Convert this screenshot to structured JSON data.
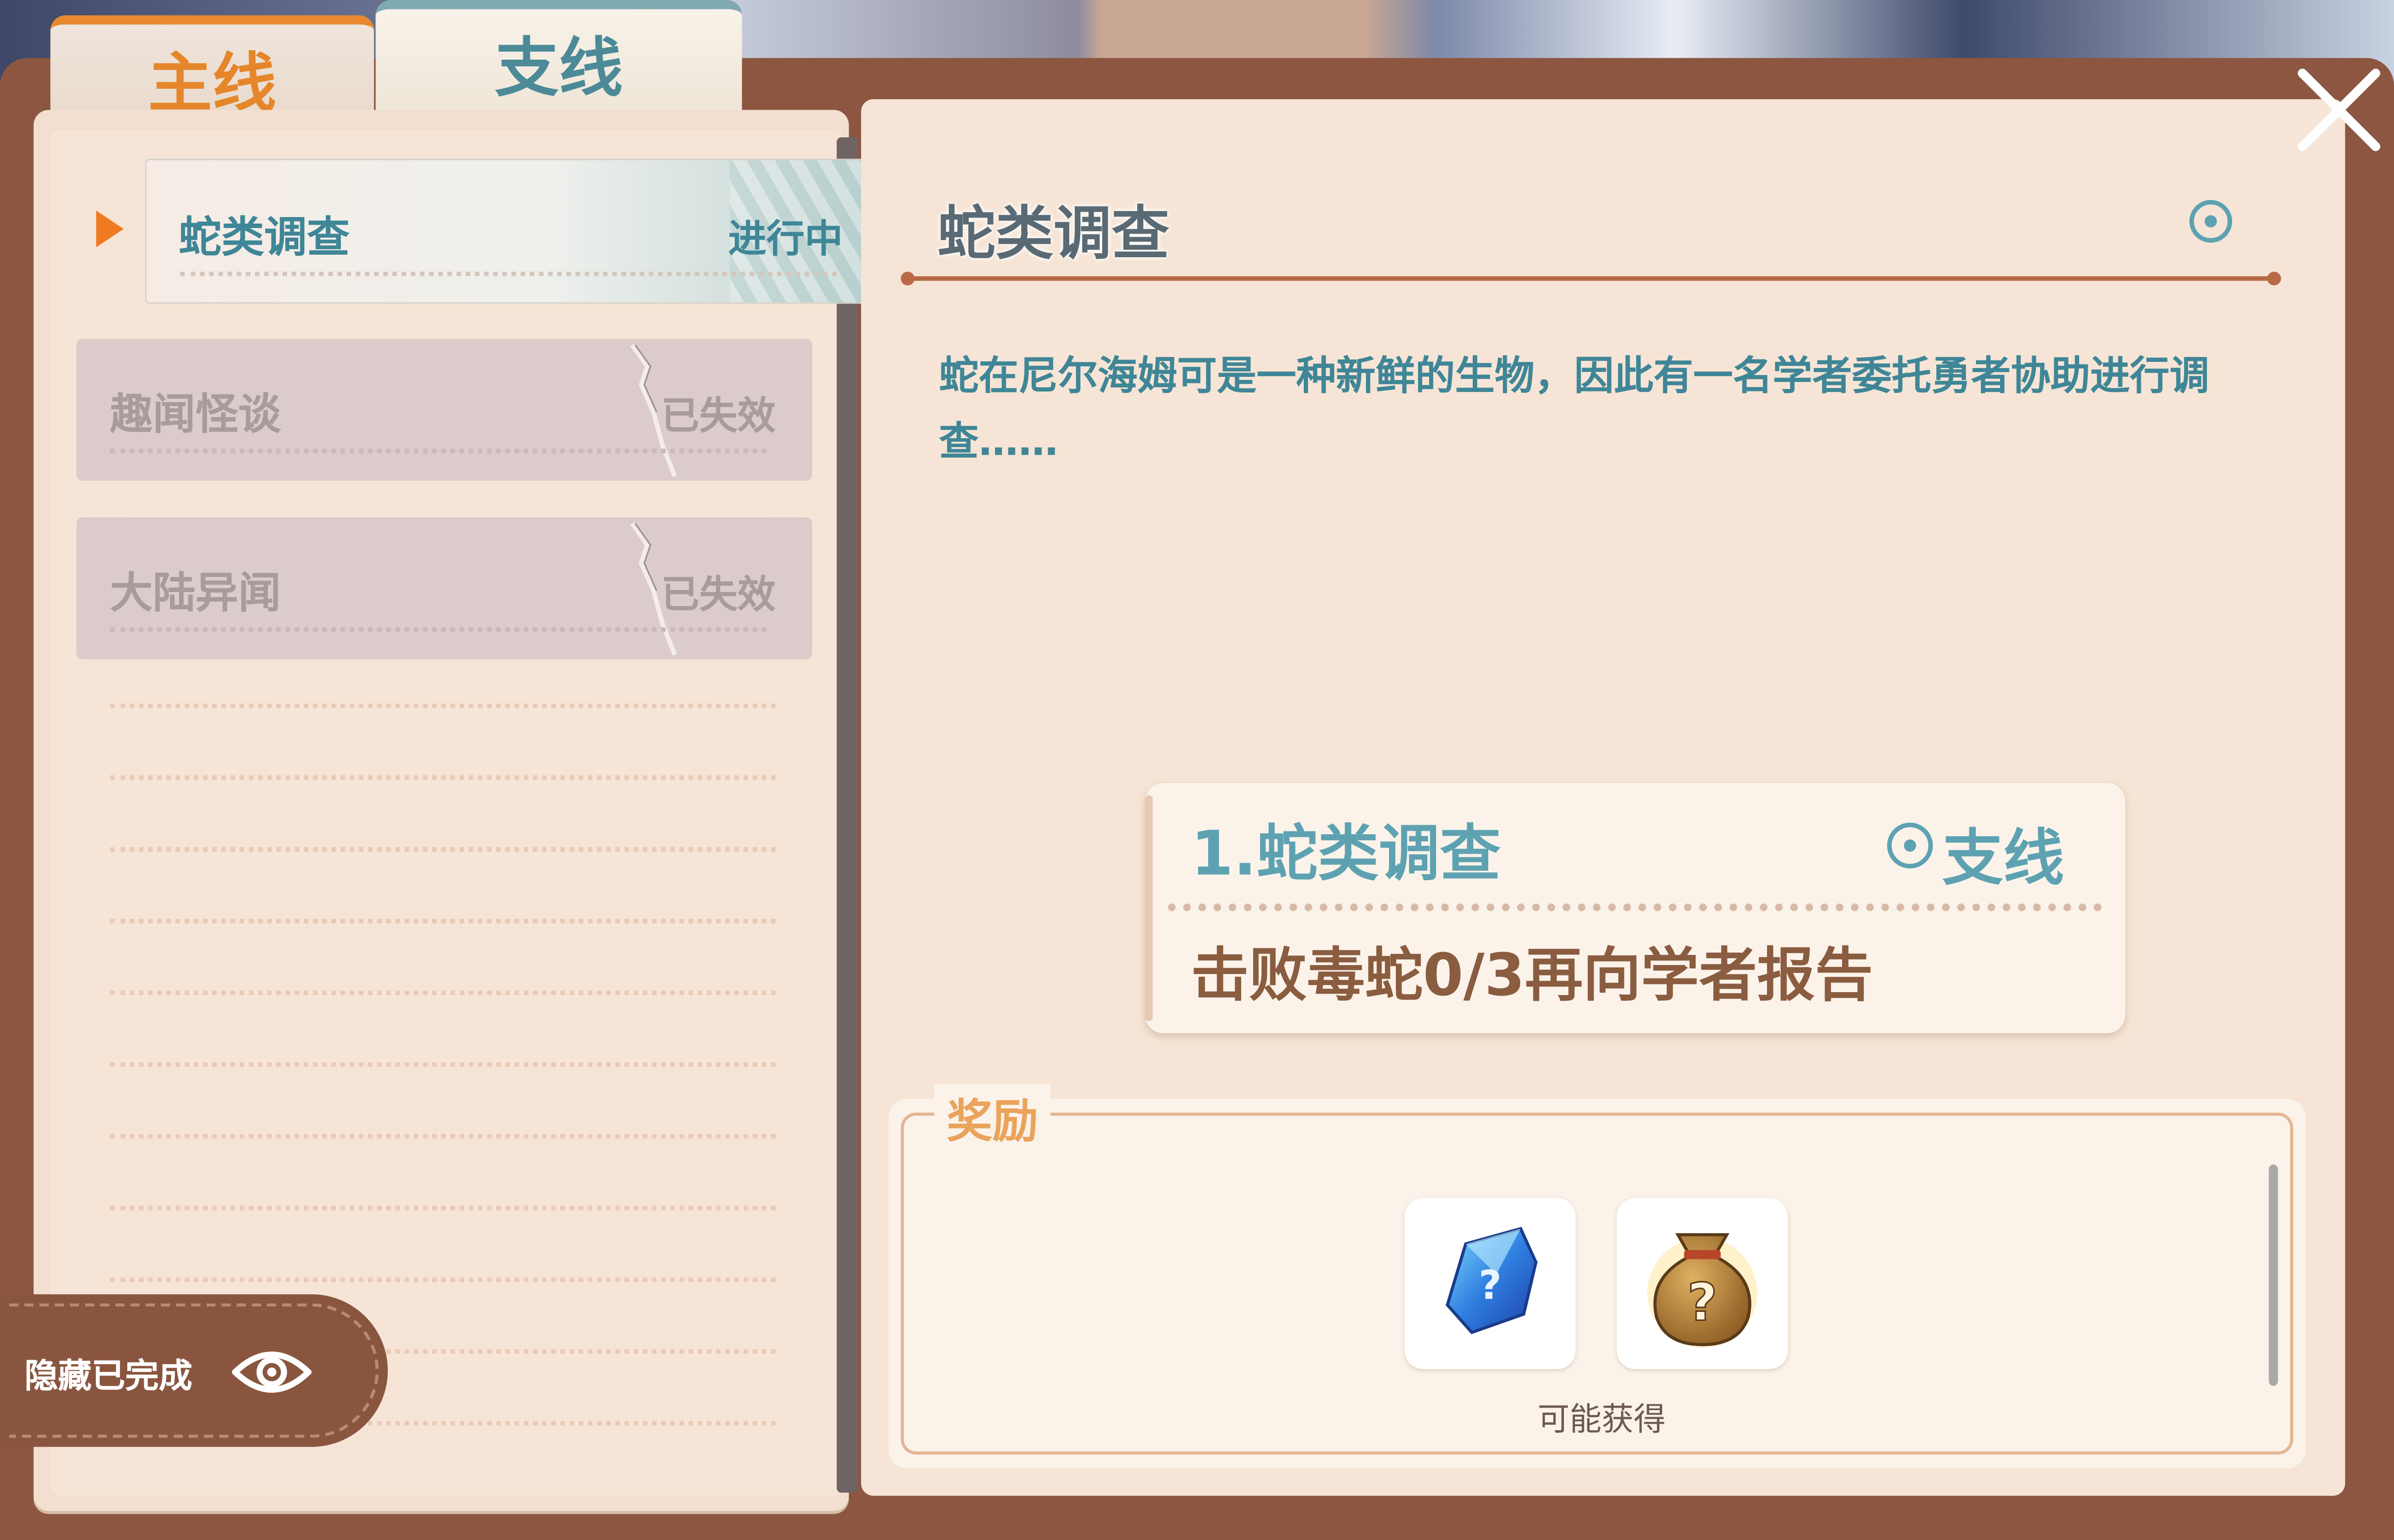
{
  "tabs": {
    "main": "主线",
    "side": "支线"
  },
  "quest_list": [
    {
      "title": "蛇类调查",
      "status": "进行中",
      "active": true
    },
    {
      "title": "趣闻怪谈",
      "status": "已失效",
      "active": false
    },
    {
      "title": "大陆异闻",
      "status": "已失效",
      "active": false
    }
  ],
  "hide_completed": {
    "label": "隐藏已完成",
    "icon": "eye-icon"
  },
  "detail": {
    "title": "蛇类调查",
    "description": "蛇在尼尔海姆可是一种新鲜的生物，因此有一名学者委托勇者协助进行调查……",
    "objective": {
      "title": "1.蛇类调查",
      "type": "支线",
      "text": "击败毒蛇0/3再向学者报告"
    }
  },
  "rewards": {
    "label": "奖励",
    "items": [
      {
        "icon": "mystery-crystal-icon"
      },
      {
        "icon": "mystery-bag-icon"
      }
    ],
    "caption": "可能获得"
  },
  "colors": {
    "accent_orange": "#e5862a",
    "accent_teal": "#5ea2b2",
    "frame_brown": "#8c5640",
    "paper": "#f6e5d6"
  }
}
